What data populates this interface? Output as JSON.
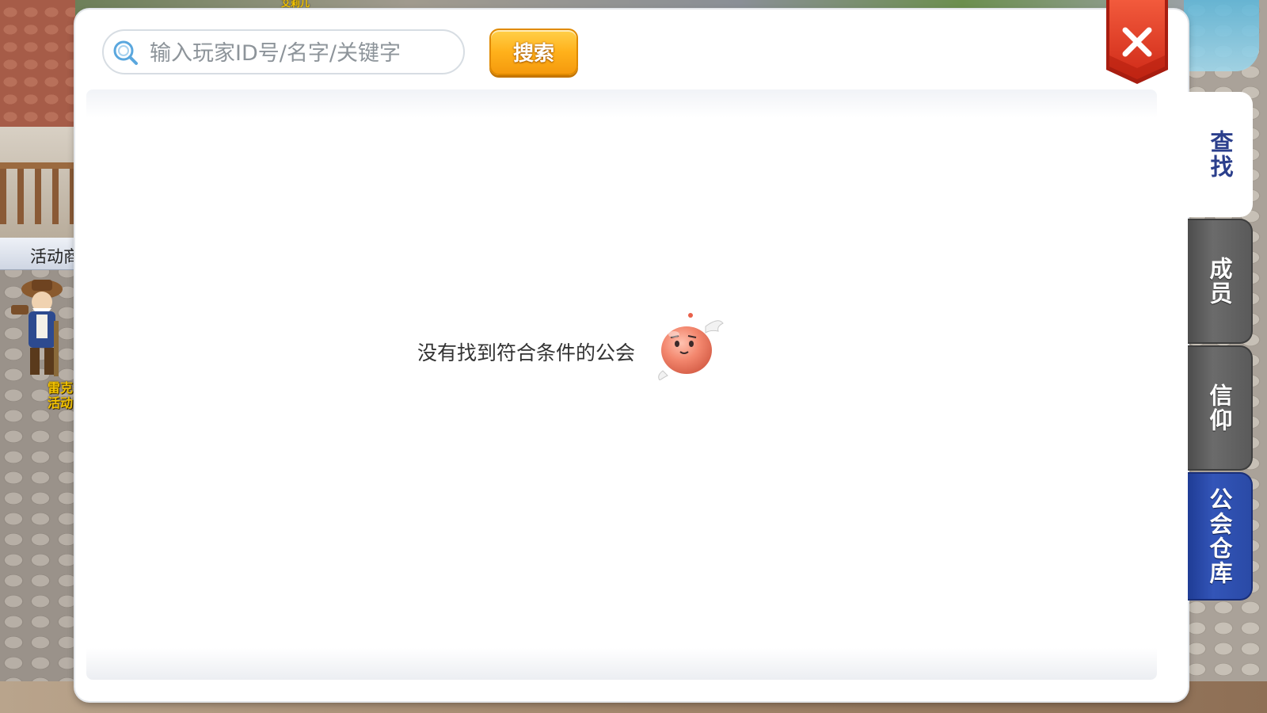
{
  "background": {
    "npc_label": "活动商",
    "npc_name_lines": [
      "雷克拉",
      "活动商"
    ],
    "top_name": "艾莉儿"
  },
  "search": {
    "placeholder": "输入玩家ID号/名字/关键字",
    "value": "",
    "button_label": "搜索",
    "icon": "search-icon"
  },
  "results": {
    "empty_message": "没有找到符合条件的公会",
    "mascot_icon": "poring-mascot-icon"
  },
  "close": {
    "icon": "close-icon"
  },
  "tabs": [
    {
      "label": "查找",
      "state": "active"
    },
    {
      "label": "成员",
      "state": "inactive"
    },
    {
      "label": "信仰",
      "state": "inactive"
    },
    {
      "label": "公会仓库",
      "state": "highlight"
    }
  ],
  "colors": {
    "search_button": "#ffb11b",
    "close_button": "#e23a22",
    "tab_active_text": "#2b3f8c",
    "tab_inactive": "#5a5a5a",
    "tab_highlight": "#2a4aa6"
  }
}
